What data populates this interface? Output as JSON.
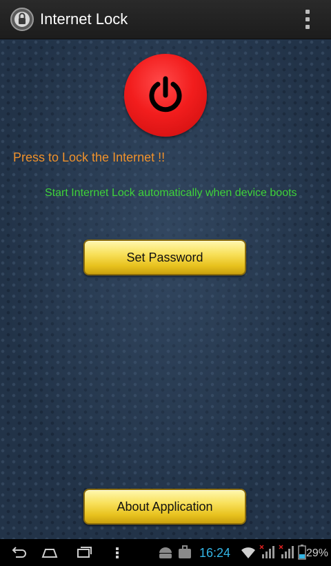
{
  "action_bar": {
    "title": "Internet Lock",
    "app_icon": "internet-lock-app-icon",
    "overflow_icon": "overflow-menu-icon"
  },
  "main": {
    "power_icon": "power-icon",
    "lock_label": "Press to Lock the Internet !!",
    "autostart_text": "Start Internet Lock automatically when device boots",
    "set_password_label": "Set Password",
    "about_label": "About Application"
  },
  "system_bar": {
    "time": "16:24",
    "battery": "29%",
    "icons": [
      "back-icon",
      "home-icon",
      "recent-apps-icon",
      "menu-icon",
      "android-icon",
      "briefcase-icon",
      "wifi-icon",
      "signal-icon",
      "battery-icon"
    ]
  },
  "colors": {
    "power_red": "#f21d1d",
    "label_orange": "#f0922c",
    "autostart_green": "#3fd43a",
    "button_gold": "#e8c21e",
    "clock_blue": "#33b5e5"
  }
}
